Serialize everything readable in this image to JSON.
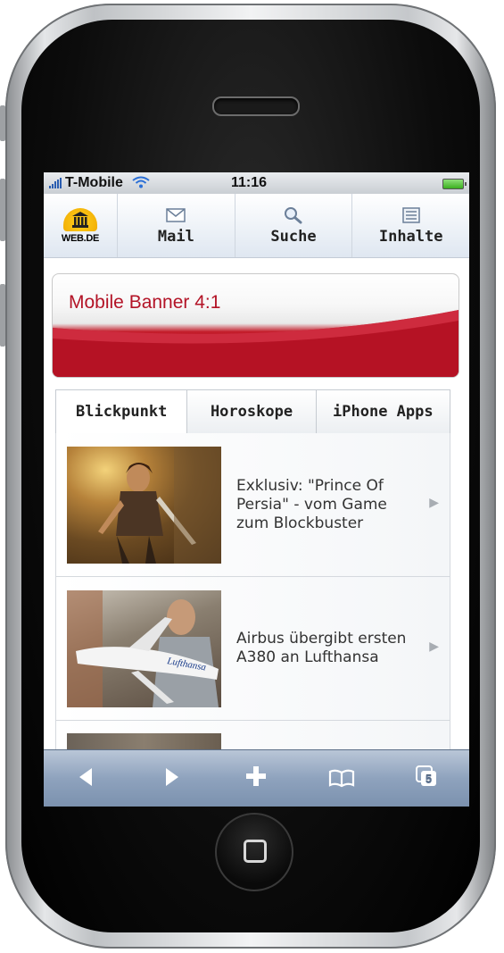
{
  "status_bar": {
    "carrier": "T-Mobile",
    "time": "11:16"
  },
  "nav": {
    "logo_text": "WEB.DE",
    "items": [
      {
        "label": "Mail",
        "icon": "mail-icon"
      },
      {
        "label": "Suche",
        "icon": "search-icon"
      },
      {
        "label": "Inhalte",
        "icon": "grid-icon"
      }
    ]
  },
  "banner": {
    "text": "Mobile Banner 4:1"
  },
  "tabs": [
    "Blickpunkt",
    "Horoskope",
    "iPhone Apps"
  ],
  "articles": [
    {
      "title": "Exklusiv: \"Prince Of Persia\" - vom Game zum Blockbuster"
    },
    {
      "title": "Airbus übergibt ersten A380 an Lufthansa",
      "image_text": "Lufthansa"
    }
  ],
  "toolbar": {
    "tabs_count": "5"
  }
}
